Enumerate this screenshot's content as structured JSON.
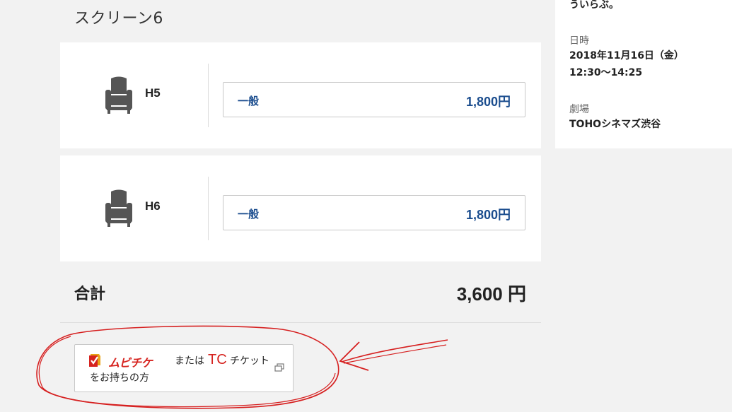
{
  "screen": {
    "title": "スクリーン6"
  },
  "seats": [
    {
      "seat": "H5",
      "ticket_type": "一般",
      "price": "1,800円"
    },
    {
      "seat": "H6",
      "ticket_type": "一般",
      "price": "1,800円"
    }
  ],
  "total": {
    "label": "合計",
    "value": "3,600 円"
  },
  "mubichike": {
    "wordmark": "ムビチケ",
    "mata_wa": "または",
    "tc_logo": "TC",
    "ticket_label": "チケット",
    "holder_label": "をお持ちの方"
  },
  "side": {
    "prev_text": "ういらぶ。",
    "datetime_label": "日時",
    "date": "2018年11月16日（金）",
    "time": "12:30〜14:25",
    "theater_label": "劇場",
    "theater": "TOHOシネマズ渋谷"
  },
  "colors": {
    "accent": "#1b4d8e",
    "mubichike_red": "#d6231f",
    "annotation_red": "#d62020",
    "seat_icon": "#555555"
  },
  "icons": {
    "seat": "seat-icon",
    "external": "external-link-icon"
  }
}
